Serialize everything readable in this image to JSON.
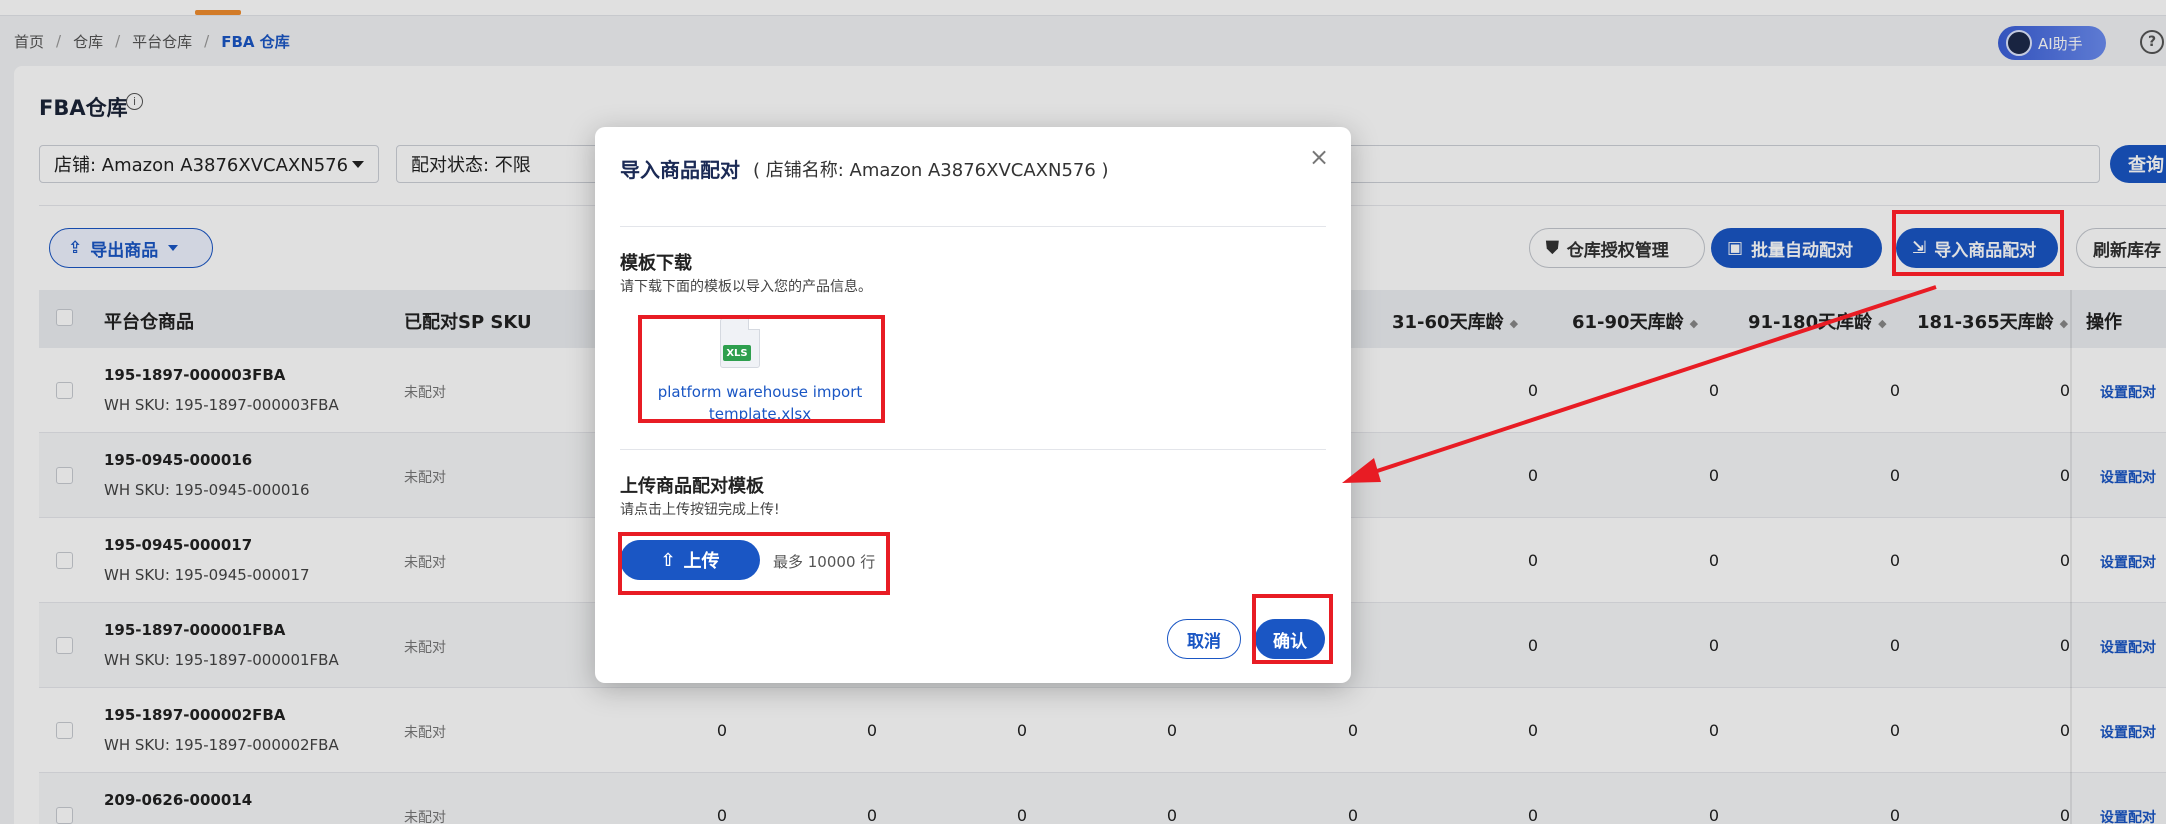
{
  "breadcrumb": [
    "首页",
    "仓库",
    "平台仓库",
    "FBA 仓库"
  ],
  "ai_assistant": "AI助手",
  "page": {
    "title": "FBA仓库"
  },
  "filters": {
    "store": "店铺: Amazon A3876XVCAXN576",
    "match_status": "配对状态: 不限",
    "query": "查询"
  },
  "toolbar": {
    "export": "导出商品",
    "auth": "仓库授权管理",
    "batch_match": "批量自动配对",
    "import_match": "导入商品配对",
    "refresh": "刷新库存"
  },
  "table": {
    "headers": {
      "product": "平台仓商品",
      "matched_sku": "已配对SP SKU",
      "age_31_60": "31-60天库龄",
      "age_61_90": "61-90天库龄",
      "age_91_180": "91-180天库龄",
      "age_181_365": "181-365天库龄",
      "ops": "操作"
    },
    "rows": [
      {
        "title": "195-1897-000003FBA",
        "sku": "WH SKU: 195-1897-000003FBA",
        "status": "未配对",
        "cols": [
          "0",
          "0",
          "0",
          "0"
        ],
        "action": "设置配对"
      },
      {
        "title": "195-0945-000016",
        "sku": "WH SKU: 195-0945-000016",
        "status": "未配对",
        "cols": [
          "0",
          "0",
          "0",
          "0"
        ],
        "action": "设置配对"
      },
      {
        "title": "195-0945-000017",
        "sku": "WH SKU: 195-0945-000017",
        "status": "未配对",
        "cols": [
          "0",
          "0",
          "0",
          "0"
        ],
        "action": "设置配对"
      },
      {
        "title": "195-1897-000001FBA",
        "sku": "WH SKU: 195-1897-000001FBA",
        "status": "未配对",
        "cols": [
          "0",
          "0",
          "0",
          "0"
        ],
        "action": "设置配对"
      },
      {
        "title": "195-1897-000002FBA",
        "sku": "WH SKU: 195-1897-000002FBA",
        "status": "未配对",
        "extra": [
          "0",
          "0",
          "0",
          "0",
          "0"
        ],
        "cols": [
          "0",
          "0",
          "0",
          "0"
        ],
        "action": "设置配对"
      },
      {
        "title": "209-0626-000014",
        "sku": "",
        "status": "未配对",
        "extra": [
          "0",
          "0",
          "0",
          "0",
          "0"
        ],
        "cols": [
          "0",
          "0",
          "0",
          "0"
        ],
        "action": "设置配对"
      }
    ]
  },
  "modal": {
    "title": "导入商品配对",
    "subtitle": "( 店铺名称: Amazon A3876XVCAXN576 )",
    "close": "×",
    "download_title": "模板下载",
    "download_desc": "请下载下面的模板以导入您的产品信息。",
    "file_badge": "XLS",
    "file_name": "platform warehouse import template.xlsx",
    "upload_title": "上传商品配对模板",
    "upload_desc": "请点击上传按钮完成上传!",
    "upload_button": "上传",
    "upload_hint": "最多 10000 行",
    "cancel": "取消",
    "confirm": "确认"
  },
  "colors": {
    "primary": "#1a56c4",
    "annotation": "#e81c24",
    "xls_badge": "#2e9f4e"
  }
}
